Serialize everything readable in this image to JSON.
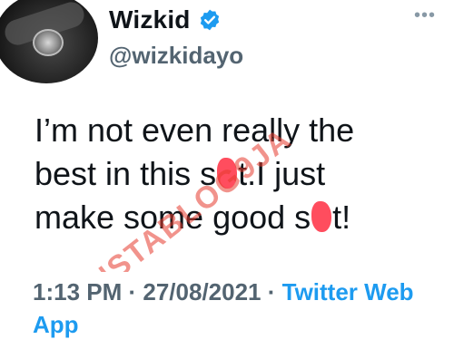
{
  "user": {
    "display_name": "Wizkid",
    "handle": "@wizkidayo",
    "verified": true
  },
  "tweet": {
    "line1": "I’m not even really the",
    "line2_a": "best in this s",
    "line2_b": "t.I just",
    "line3_a": "make some good s",
    "line3_b": "t!",
    "time": "1:13 PM",
    "separator": " · ",
    "date": "27/08/2021",
    "source": "Twitter Web App"
  },
  "more_menu": "•••",
  "watermark": {
    "text_main": "NSTABLOG9JA",
    "color": "#e63a2e"
  },
  "colors": {
    "verified_blue": "#1d9bf0",
    "link_blue": "#1d9bf0",
    "censor_pink": "#ff4d5e"
  },
  "icons": [
    "verified-badge-icon",
    "more-icon",
    "avatar"
  ]
}
